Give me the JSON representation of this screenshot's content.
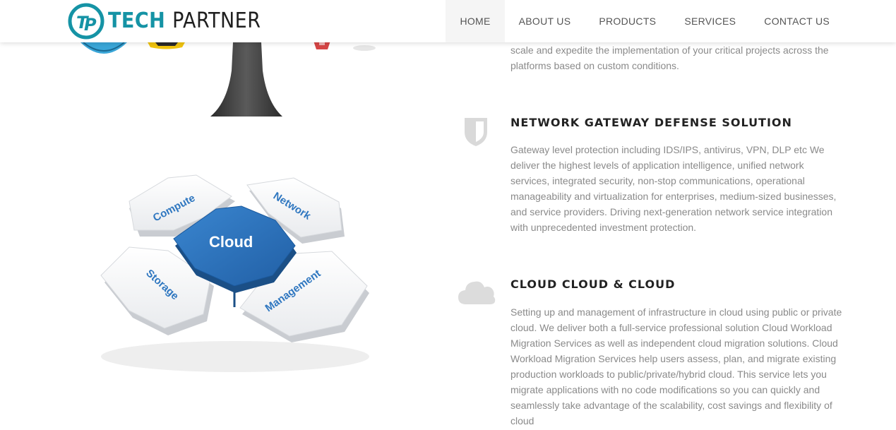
{
  "header": {
    "logo_mark": "TP",
    "logo_word1": "TECH",
    "logo_word2": "PARTNER",
    "nav": [
      {
        "label": "HOME",
        "active": true
      },
      {
        "label": "ABOUT US",
        "active": false
      },
      {
        "label": "PRODUCTS",
        "active": false
      },
      {
        "label": "SERVICES",
        "active": false
      },
      {
        "label": "CONTACT US",
        "active": false
      }
    ]
  },
  "intro": {
    "text": "scale and expedite the implementation of your critical projects across the platforms based on custom conditions."
  },
  "sections": [
    {
      "icon": "shield-icon",
      "title": "NETWORK GATEWAY DEFENSE SOLUTION",
      "text": "Gateway level protection including IDS/IPS, antivirus, VPN, DLP etc We deliver the highest levels of application intelligence, unified network services, integrated security, non-stop communications, operational manageability and virtualization for enterprises, medium-sized businesses, and service providers. Driving next-generation network service integration with unprecedented investment protection."
    },
    {
      "icon": "cloud-icon",
      "title": "CLOUD CLOUD & CLOUD",
      "text": "Setting up and management of infrastructure in cloud using public or private cloud. We deliver both a full-service professional solution Cloud Workload Migration Services as well as independent cloud migration solutions. Cloud Workload Migration Services help users assess, plan, and migrate existing production workloads to public/private/hybrid cloud. This service lets you migrate applications with no code modifications so you can quickly and seamlessly take advantage of the scalability, cost savings and flexibility of cloud"
    }
  ],
  "puzzle": {
    "center": "Cloud",
    "pieces": [
      "Compute",
      "Network",
      "Storage",
      "Management"
    ]
  },
  "colors": {
    "brand_teal": "#1593a5",
    "puzzle_blue": "#2f77c0",
    "icon_gray": "#d9d9d9",
    "text_gray": "#8a8a8a"
  }
}
